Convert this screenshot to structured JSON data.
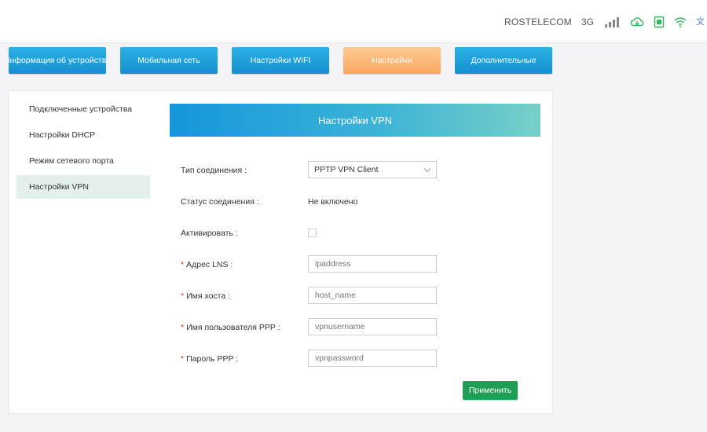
{
  "status_bar": {
    "operator": "ROSTELECOM",
    "network_type": "3G",
    "signal_bars": 4,
    "icons": [
      "signal-icon",
      "cloud-sync-icon",
      "sim-card-icon",
      "wifi-icon",
      "translate-icon"
    ],
    "accent_color": "#2fb85b"
  },
  "nav": {
    "tabs": [
      {
        "label": "Информация об устройстве",
        "active": false
      },
      {
        "label": "Мобильная сеть",
        "active": false
      },
      {
        "label": "Настройки WIFI",
        "active": false
      },
      {
        "label": "Настройки",
        "active": true
      },
      {
        "label": "Дополнительные",
        "active": false
      }
    ]
  },
  "sidebar": {
    "items": [
      {
        "label": "Подключенные устройства",
        "active": false
      },
      {
        "label": "Настройки DHCP",
        "active": false
      },
      {
        "label": "Режим сетевого порта",
        "active": false
      },
      {
        "label": "Настройки VPN",
        "active": true
      }
    ]
  },
  "vpn": {
    "title": "Настройки VPN",
    "connection_type": {
      "label": "Тип соединения :",
      "value": "PPTP VPN Client"
    },
    "connection_status": {
      "label": "Статус соединения :",
      "value": "Не включено"
    },
    "activate": {
      "label": "Активировать :",
      "checked": false
    },
    "lns_address": {
      "label": "Адрес LNS :",
      "placeholder": "ipaddress",
      "required": true
    },
    "host_name": {
      "label": "Имя хоста :",
      "placeholder": "host_name",
      "required": true
    },
    "ppp_username": {
      "label": "Имя пользователя PPP :",
      "placeholder": "vpnusername",
      "required": true
    },
    "ppp_password": {
      "label": "Пароль PPP :",
      "placeholder": "vpnpassword",
      "required": true
    },
    "apply_label": "Применить",
    "required_marker": "*"
  }
}
